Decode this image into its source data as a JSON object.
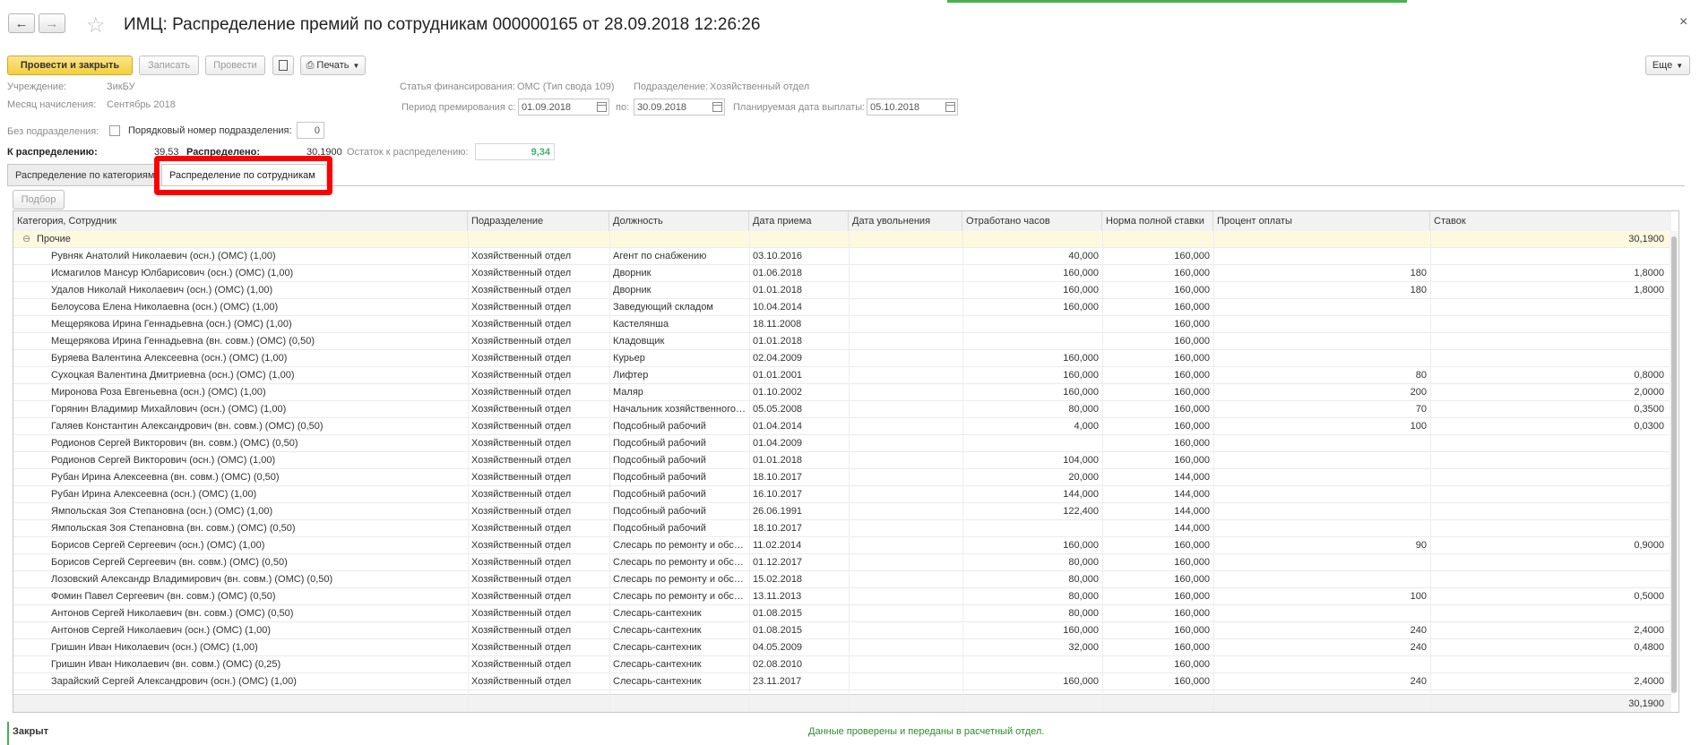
{
  "window": {
    "title": "ИМЦ: Распределение премий по сотрудникам 000000165 от 28.09.2018 12:26:26"
  },
  "toolbar": {
    "post_close": "Провести и закрыть",
    "save": "Записать",
    "post": "Провести",
    "print": "Печать",
    "more": "Еще"
  },
  "header": {
    "institution_label": "Учреждение:",
    "institution_value": "ЗикБУ",
    "month_label": "Месяц начисления:",
    "month_value": "Сентябрь 2018",
    "fin_label": "Статья финансирования:",
    "fin_value": "ОМС (Тип свода 109)",
    "dept_label": "Подразделение:",
    "dept_value": "Хозяйственный отдел",
    "period_label": "Период премирования с:",
    "period_from": "01.09.2018",
    "period_to_label": "по:",
    "period_to": "30.09.2018",
    "pay_date_label": "Планируемая дата выплаты:",
    "pay_date": "05.10.2018",
    "no_dept_label": "Без подразделения:",
    "dept_number_label": "Порядковый номер подразделения:",
    "dept_number": "0",
    "to_distribute_label": "К распределению:",
    "to_distribute": "39,53",
    "distributed_label": "Распределено:",
    "distributed": "30,1900",
    "remainder_label": "Остаток к распределению:",
    "remainder": "9,34"
  },
  "tabs": [
    {
      "label": "Распределение по категориям"
    },
    {
      "label": "Распределение по сотрудникам"
    }
  ],
  "select_button": "Подбор",
  "columns": [
    "Категория, Сотрудник",
    "Подразделение",
    "Должность",
    "Дата приема",
    "Дата увольнения",
    "Отработано часов",
    "Норма полной ставки",
    "Процент оплаты",
    "Ставок"
  ],
  "group": {
    "name": "Прочие",
    "total": "30,1900"
  },
  "rows": [
    [
      "Рувняк Анатолий Николаевич (осн.) (ОМС) (1,00)",
      "Хозяйственный отдел",
      "Агент по снабжению",
      "03.10.2016",
      "",
      "40,000",
      "160,000",
      "",
      ""
    ],
    [
      "Исмагилов Мансур Юлбарисович (осн.) (ОМС) (1,00)",
      "Хозяйственный отдел",
      "Дворник",
      "01.06.2018",
      "",
      "160,000",
      "160,000",
      "180",
      "1,8000"
    ],
    [
      "Удалов Николай Николаевич (осн.) (ОМС) (1,00)",
      "Хозяйственный отдел",
      "Дворник",
      "01.01.2018",
      "",
      "160,000",
      "160,000",
      "180",
      "1,8000"
    ],
    [
      "Белоусова Елена Николаевна (осн.) (ОМС) (1,00)",
      "Хозяйственный отдел",
      "Заведующий складом",
      "10.04.2014",
      "",
      "160,000",
      "160,000",
      "",
      ""
    ],
    [
      "Мещерякова Ирина Геннадьевна (осн.) (ОМС) (1,00)",
      "Хозяйственный отдел",
      "Кастелянша",
      "18.11.2008",
      "",
      "",
      "160,000",
      "",
      ""
    ],
    [
      "Мещерякова Ирина Геннадьевна (вн. совм.) (ОМС) (0,50)",
      "Хозяйственный отдел",
      "Кладовщик",
      "01.01.2018",
      "",
      "",
      "160,000",
      "",
      ""
    ],
    [
      "Буряева Валентина Алексеевна (осн.) (ОМС) (1,00)",
      "Хозяйственный отдел",
      "Курьер",
      "02.04.2009",
      "",
      "160,000",
      "160,000",
      "",
      ""
    ],
    [
      "Сухоцкая Валентина Дмитриевна (осн.) (ОМС) (1,00)",
      "Хозяйственный отдел",
      "Лифтер",
      "01.01.2001",
      "",
      "160,000",
      "160,000",
      "80",
      "0,8000"
    ],
    [
      "Миронова Роза Евгеньевна (осн.) (ОМС) (1,00)",
      "Хозяйственный отдел",
      "Маляр",
      "01.10.2002",
      "",
      "160,000",
      "160,000",
      "200",
      "2,0000"
    ],
    [
      "Горянин Владимир Михайлович (осн.) (ОМС) (1,00)",
      "Хозяйственный отдел",
      "Начальник хозяйственного отдела",
      "05.05.2008",
      "",
      "80,000",
      "160,000",
      "70",
      "0,3500"
    ],
    [
      "Галяев Константин Александрович (вн. совм.) (ОМС) (0,50)",
      "Хозяйственный отдел",
      "Подсобный рабочий",
      "01.04.2014",
      "",
      "4,000",
      "160,000",
      "100",
      "0,0300"
    ],
    [
      "Родионов Сергей Викторович (вн. совм.) (ОМС) (0,50)",
      "Хозяйственный отдел",
      "Подсобный рабочий",
      "01.04.2009",
      "",
      "",
      "160,000",
      "",
      ""
    ],
    [
      "Родионов Сергей Викторович (осн.) (ОМС) (1,00)",
      "Хозяйственный отдел",
      "Подсобный рабочий",
      "01.01.2018",
      "",
      "104,000",
      "160,000",
      "",
      ""
    ],
    [
      "Рубан Ирина Алексеевна (вн. совм.) (ОМС) (0,50)",
      "Хозяйственный отдел",
      "Подсобный рабочий",
      "18.10.2017",
      "",
      "20,000",
      "144,000",
      "",
      ""
    ],
    [
      "Рубан Ирина Алексеевна (осн.) (ОМС) (1,00)",
      "Хозяйственный отдел",
      "Подсобный рабочий",
      "16.10.2017",
      "",
      "144,000",
      "144,000",
      "",
      ""
    ],
    [
      "Ямпольская Зоя Степановна (осн.) (ОМС) (1,00)",
      "Хозяйственный отдел",
      "Подсобный рабочий",
      "26.06.1991",
      "",
      "122,400",
      "144,000",
      "",
      ""
    ],
    [
      "Ямпольская Зоя Степановна (вн. совм.) (ОМС) (0,50)",
      "Хозяйственный отдел",
      "Подсобный рабочий",
      "18.10.2017",
      "",
      "",
      "144,000",
      "",
      ""
    ],
    [
      "Борисов Сергей Сергеевич (осн.) (ОМС) (1,00)",
      "Хозяйственный отдел",
      "Слесарь по ремонту и обслуживанию",
      "11.02.2014",
      "",
      "160,000",
      "160,000",
      "90",
      "0,9000"
    ],
    [
      "Борисов Сергей Сергеевич (вн. совм.) (ОМС) (0,50)",
      "Хозяйственный отдел",
      "Слесарь по ремонту и обслуживанию",
      "01.12.2017",
      "",
      "80,000",
      "160,000",
      "",
      ""
    ],
    [
      "Лозовский Александр Владимирович (вн. совм.) (ОМС) (0,50)",
      "Хозяйственный отдел",
      "Слесарь по ремонту и обслуживанию",
      "15.02.2018",
      "",
      "80,000",
      "160,000",
      "",
      ""
    ],
    [
      "Фомин Павел Сергеевич (вн. совм.) (ОМС) (0,50)",
      "Хозяйственный отдел",
      "Слесарь по ремонту и обслуживанию",
      "13.11.2013",
      "",
      "80,000",
      "160,000",
      "100",
      "0,5000"
    ],
    [
      "Антонов Сергей Николаевич (вн. совм.) (ОМС) (0,50)",
      "Хозяйственный отдел",
      "Слесарь-сантехник",
      "01.08.2015",
      "",
      "80,000",
      "160,000",
      "",
      ""
    ],
    [
      "Антонов Сергей Николаевич (осн.) (ОМС) (1,00)",
      "Хозяйственный отдел",
      "Слесарь-сантехник",
      "01.08.2015",
      "",
      "160,000",
      "160,000",
      "240",
      "2,4000"
    ],
    [
      "Гришин Иван Николаевич (осн.) (ОМС) (1,00)",
      "Хозяйственный отдел",
      "Слесарь-сантехник",
      "04.05.2009",
      "",
      "32,000",
      "160,000",
      "240",
      "0,4800"
    ],
    [
      "Гришин Иван Николаевич (вн. совм.) (ОМС) (0,25)",
      "Хозяйственный отдел",
      "Слесарь-сантехник",
      "02.08.2010",
      "",
      "",
      "160,000",
      "",
      ""
    ],
    [
      "Зарайский Сергей Александрович (осн.) (ОМС) (1,00)",
      "Хозяйственный отдел",
      "Слесарь-сантехник",
      "23.11.2017",
      "",
      "160,000",
      "160,000",
      "240",
      "2,4000"
    ]
  ],
  "footer_total": "30,1900",
  "status": {
    "state": "Закрыт",
    "message": "Данные проверены и переданы в расчетный отдел."
  },
  "colors": {
    "accent_yellow": "#f3cf3c",
    "highlight": "#ff0000",
    "ok_green": "#2e8b2e"
  }
}
